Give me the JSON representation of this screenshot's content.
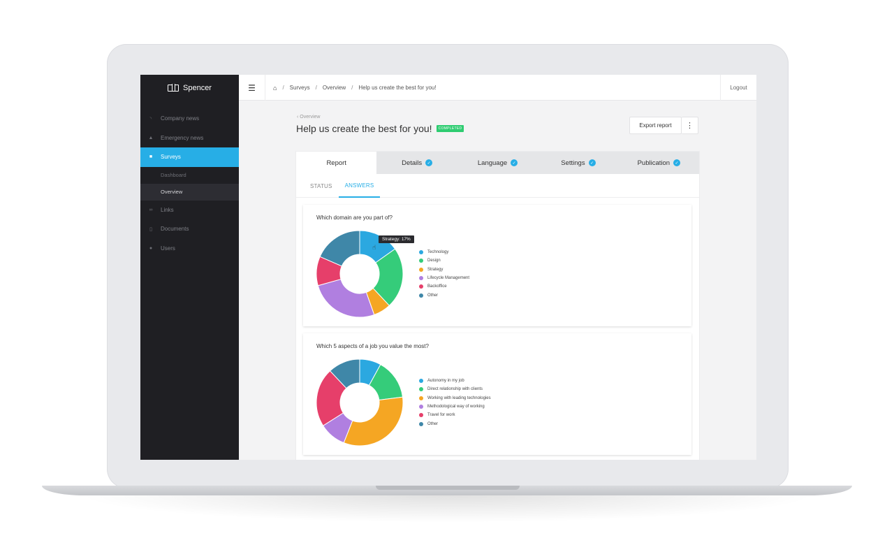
{
  "sidebar": {
    "brand": "Spencer",
    "items": [
      {
        "label": "Company news",
        "icon": "rss-icon"
      },
      {
        "label": "Emergency news",
        "icon": "bell-icon"
      },
      {
        "label": "Surveys",
        "icon": "survey-icon"
      },
      {
        "label": "Links",
        "icon": "link-icon"
      },
      {
        "label": "Documents",
        "icon": "document-icon"
      },
      {
        "label": "Users",
        "icon": "users-icon"
      }
    ],
    "sub_items": [
      "Dashboard",
      "Overview"
    ]
  },
  "topbar": {
    "breadcrumbs": [
      "Surveys",
      "Overview",
      "Help us create the best for you!"
    ],
    "logout": "Logout"
  },
  "header": {
    "back": "Overview",
    "title": "Help us create the best for you!",
    "badge": "COMPLETED",
    "export": "Export report"
  },
  "tabs": [
    "Report",
    "Details",
    "Language",
    "Settings",
    "Publication"
  ],
  "subtabs": [
    "STATUS",
    "ANSWERS"
  ],
  "colors": {
    "accent": "#27aee6",
    "blue": "#2ba8e0",
    "green": "#35cc7a",
    "orange": "#f5a623",
    "purple": "#b07fe0",
    "red": "#e63f6a",
    "steel": "#3f87a8"
  },
  "chart_data": [
    {
      "type": "pie",
      "title": "Which domain are you part of?",
      "categories": [
        "Technology",
        "Design",
        "Strategy",
        "Lifecycle Management",
        "Backoffice",
        "Other"
      ],
      "values": [
        14,
        21,
        6,
        24,
        10,
        17
      ],
      "tooltip": "Strategy: 17%"
    },
    {
      "type": "pie",
      "title": "Which 5 aspects of a job you value the most?",
      "categories": [
        "Autonomy in my job",
        "Direct relationship with clients",
        "Working with leading technologies",
        "Methodological way of working",
        "Travel for work",
        "Other"
      ],
      "values": [
        8,
        15,
        33,
        10,
        22,
        12
      ]
    }
  ]
}
